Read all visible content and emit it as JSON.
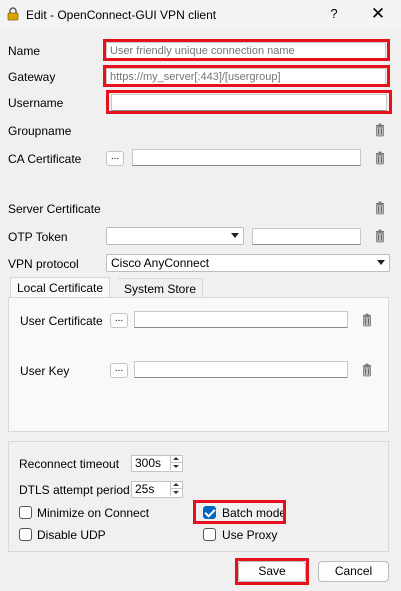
{
  "window": {
    "title": "Edit - OpenConnect-GUI VPN client",
    "help_label": "?",
    "close_label": "✕"
  },
  "form": {
    "name_label": "Name",
    "name_placeholder": "User friendly unique connection name",
    "gateway_label": "Gateway",
    "gateway_placeholder": "https://my_server[:443]/[usergroup]",
    "username_label": "Username",
    "username_value": "",
    "groupname_label": "Groupname",
    "ca_certificate_label": "CA Certificate",
    "ca_browse_label": "...",
    "ca_value": "",
    "server_certificate_label": "Server Certificate",
    "otp_token_label": "OTP Token",
    "otp_type_value": "",
    "otp_value": "",
    "vpn_protocol_label": "VPN protocol",
    "vpn_protocol_value": "Cisco AnyConnect"
  },
  "tabs": [
    {
      "label": "Local Certificate",
      "active": true
    },
    {
      "label": "System Store",
      "active": false
    }
  ],
  "local_certificate": {
    "user_certificate_label": "User Certificate",
    "user_certificate_browse": "...",
    "user_certificate_value": "",
    "user_key_label": "User Key",
    "user_key_browse": "...",
    "user_key_value": ""
  },
  "options": {
    "reconnect_timeout_label": "Reconnect timeout",
    "reconnect_timeout_value": "300s",
    "dtls_attempt_label": "DTLS attempt period",
    "dtls_attempt_value": "25s",
    "minimize_on_connect_label": "Minimize on Connect",
    "minimize_on_connect_checked": false,
    "batch_mode_label": "Batch mode",
    "batch_mode_checked": true,
    "disable_udp_label": "Disable UDP",
    "disable_udp_checked": false,
    "use_proxy_label": "Use Proxy",
    "use_proxy_checked": false
  },
  "buttons": {
    "save_label": "Save",
    "cancel_label": "Cancel"
  },
  "colors": {
    "highlight": "#e8101a",
    "accent": "#0067c0"
  },
  "icons": {
    "app": "vpn-lock-icon",
    "clear": "trash-icon"
  }
}
